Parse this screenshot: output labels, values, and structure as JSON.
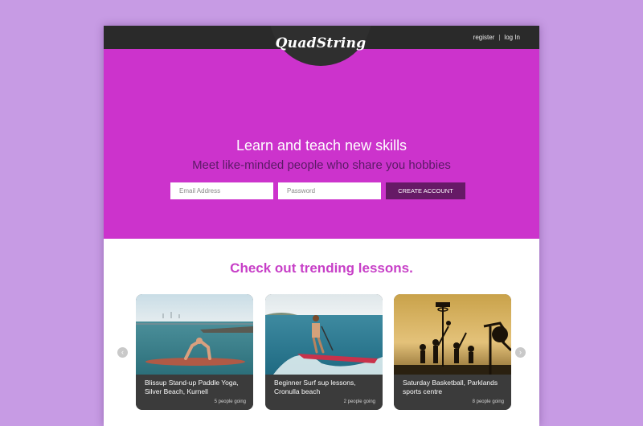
{
  "header": {
    "logo": "QuadString",
    "register": "register",
    "separator": "|",
    "login": "log In"
  },
  "hero": {
    "title": "Learn and teach new skills",
    "subtitle": "Meet like-minded people who share you hobbies",
    "email_placeholder": "Email Address",
    "password_placeholder": "Password",
    "cta": "CREATE ACCOUNT"
  },
  "trending": {
    "title": "Check out trending lessons.",
    "prev_arrow": "‹",
    "next_arrow": "›",
    "lessons": [
      {
        "name": "Blissup Stand-up Paddle Yoga, Silver Beach, Kurnell",
        "going": "5 people going"
      },
      {
        "name": "Beginner Surf sup lessons, Cronulla beach",
        "going": "2 people going"
      },
      {
        "name": "Saturday Basketball, Parklands sports centre",
        "going": "8 people going"
      }
    ]
  },
  "colors": {
    "page_background": "#c79be4",
    "hero": "#cc33cc",
    "topbar": "#2a2a2a",
    "cta": "#661a66",
    "heading_accent": "#c73fc7"
  }
}
